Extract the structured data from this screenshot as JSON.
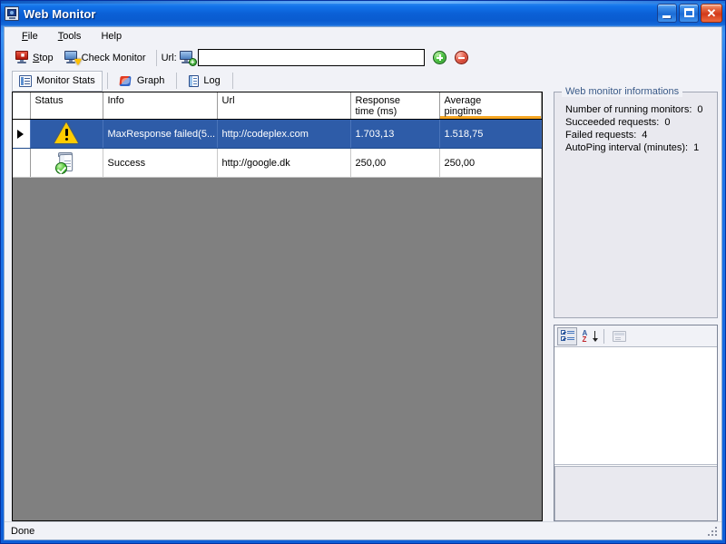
{
  "window": {
    "title": "Web Monitor",
    "app_icon": "monitor-icon",
    "minimize_label": "Minimize",
    "maximize_label": "Maximize",
    "close_label": "Close",
    "close_glyph": "✕"
  },
  "menu": {
    "items": [
      {
        "label": "File",
        "mnemonic": "F"
      },
      {
        "label": "Tools",
        "mnemonic": "T"
      },
      {
        "label": "Help",
        "mnemonic": ""
      }
    ]
  },
  "toolbar": {
    "stop_label": "Stop",
    "stop_mnemonic": "S",
    "stop_icon": "stop-monitor-icon",
    "check_monitor_label": "Check Monitor",
    "check_monitor_icon": "check-monitor-icon",
    "url_label": "Url:",
    "url_icon": "add-monitor-icon",
    "url_value": "",
    "url_placeholder": "",
    "add_button_label": "Add",
    "add_button_icon": "plus-circle-icon",
    "remove_button_label": "Remove",
    "remove_button_icon": "minus-circle-icon"
  },
  "tabs": {
    "items": [
      {
        "label": "Monitor Stats",
        "icon": "list-icon",
        "active": true
      },
      {
        "label": "Graph",
        "icon": "graph-icon",
        "active": false
      },
      {
        "label": "Log",
        "icon": "log-book-icon",
        "active": false
      }
    ]
  },
  "grid": {
    "columns": [
      {
        "key": "rowhdr",
        "label": ""
      },
      {
        "key": "status",
        "label": "Status"
      },
      {
        "key": "info",
        "label": "Info"
      },
      {
        "key": "url",
        "label": "Url"
      },
      {
        "key": "response",
        "label": "Response\ntime (ms)"
      },
      {
        "key": "average",
        "label": "Average\npingtime",
        "sorted": true
      }
    ],
    "rows": [
      {
        "selected": true,
        "current": true,
        "status_icon": "warning-triangle-icon",
        "info": "MaxResponse failed(5...",
        "url": "http://codeplex.com",
        "response": "1.703,13",
        "average": "1.518,75"
      },
      {
        "selected": false,
        "current": false,
        "status_icon": "server-success-icon",
        "info": "Success",
        "url": "http://google.dk",
        "response": "250,00",
        "average": "250,00"
      }
    ]
  },
  "info_panel": {
    "title": "Web monitor informations",
    "rows": [
      {
        "label": "Number of running  monitors:",
        "value": "0"
      },
      {
        "label": "Succeeded requests:",
        "value": "0"
      },
      {
        "label": "Failed requests:",
        "value": "4"
      },
      {
        "label": "AutoPing interval (minutes):",
        "value": "1"
      }
    ]
  },
  "property_grid": {
    "buttons": [
      {
        "name": "categorized",
        "icon": "categorized-icon",
        "label": "Categorized",
        "pressed": true,
        "disabled": false
      },
      {
        "name": "alphabetical",
        "icon": "sort-az-icon",
        "label": "Alphabetical",
        "pressed": false,
        "disabled": false
      },
      {
        "name": "property-pages",
        "icon": "property-pages-icon",
        "label": "Property Pages",
        "pressed": false,
        "disabled": true
      }
    ],
    "description": ""
  },
  "statusbar": {
    "text": "Done"
  },
  "colors": {
    "title_blue": "#0B60D6",
    "selection_blue": "#2E5CA8",
    "grid_empty_gray": "#808080",
    "sorted_underline": "#F5A623",
    "face": "#F1F2F7",
    "warning_yellow": "#FFCC00",
    "success_green": "#229822"
  }
}
